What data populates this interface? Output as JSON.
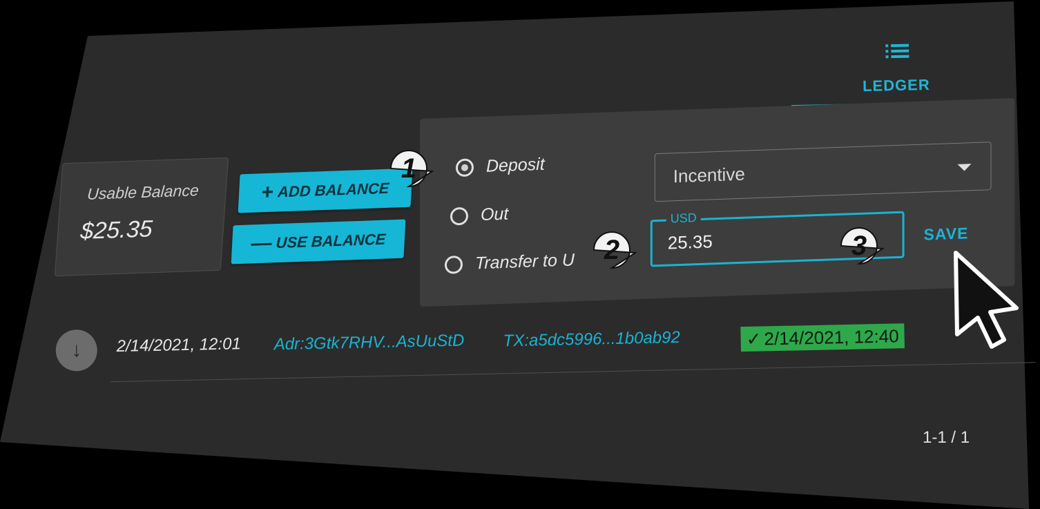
{
  "tab": {
    "label": "LEDGER",
    "icon": "list-icon"
  },
  "balance": {
    "title": "Usable Balance",
    "value": "$25.35"
  },
  "buttons": {
    "add": "ADD BALANCE",
    "use": "USE BALANCE"
  },
  "form": {
    "radio_options": [
      "Deposit",
      "Out",
      "Transfer to U"
    ],
    "selected_radio": "Deposit",
    "select_value": "Incentive",
    "currency_label": "USD",
    "amount": "25.35",
    "save_label": "SAVE"
  },
  "ledger_row": {
    "date": "2/14/2021, 12:01",
    "address": "Adr:3Gtk7RHV...AsUuStD",
    "tx": "TX:a5dc5996...1b0ab92",
    "confirmed": "2/14/2021, 12:40"
  },
  "pagination": "1-1 / 1",
  "callouts": [
    "1",
    "2",
    "3"
  ],
  "colors": {
    "accent": "#1ab3d3",
    "success": "#2ea84a",
    "panel": "#2b2b2b"
  }
}
